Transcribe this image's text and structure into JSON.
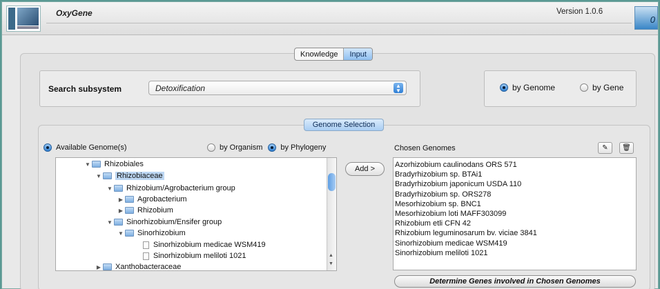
{
  "app": {
    "title": "OxyGene",
    "version": "Version 1.0.6",
    "corner_icon": "app-badge-icon",
    "corner_glyph": "0"
  },
  "tabs": [
    {
      "label": "Knowledge",
      "active": false
    },
    {
      "label": "Input",
      "active": true
    }
  ],
  "search": {
    "label": "Search subsystem",
    "selected_value": "Detoxification"
  },
  "mode": {
    "options": [
      {
        "label": "by Genome",
        "selected": true
      },
      {
        "label": "by Gene",
        "selected": false
      }
    ]
  },
  "genome_selection": {
    "section_label": "Genome Selection",
    "available_label": "Available Genome(s)",
    "filters": [
      {
        "label": "by Organism",
        "selected": false
      },
      {
        "label": "by Phylogeny",
        "selected": true
      }
    ],
    "tree": [
      {
        "label": "Rhizobiales",
        "type": "folder",
        "expanded": true
      },
      {
        "label": "Rhizobiaceae",
        "type": "folder",
        "expanded": true,
        "selected": true
      },
      {
        "label": "Rhizobium/Agrobacterium group",
        "type": "folder",
        "expanded": true
      },
      {
        "label": "Agrobacterium",
        "type": "folder",
        "expanded": false
      },
      {
        "label": "Rhizobium",
        "type": "folder",
        "expanded": false
      },
      {
        "label": "Sinorhizobium/Ensifer group",
        "type": "folder",
        "expanded": true
      },
      {
        "label": "Sinorhizobium",
        "type": "folder",
        "expanded": true
      },
      {
        "label": "Sinorhizobium medicae WSM419",
        "type": "leaf"
      },
      {
        "label": "Sinorhizobium meliloti 1021",
        "type": "leaf"
      },
      {
        "label": "Xanthobacteraceae",
        "type": "folder",
        "expanded": false
      }
    ],
    "add_button": "Add >",
    "chosen_label": "Chosen Genomes",
    "chosen_genomes": [
      "Azorhizobium caulinodans ORS 571",
      "Bradyrhizobium sp. BTAi1",
      "Bradyrhizobium japonicum USDA 110",
      "Bradyrhizobium sp. ORS278",
      "Mesorhizobium sp. BNC1",
      "Mesorhizobium loti MAFF303099",
      "Rhizobium etli CFN 42",
      "Rhizobium leguminosarum bv. viciae 3841",
      "Sinorhizobium medicae WSM419",
      "Sinorhizobium meliloti 1021"
    ],
    "determine_button": "Determine Genes involved in Chosen Genomes"
  }
}
